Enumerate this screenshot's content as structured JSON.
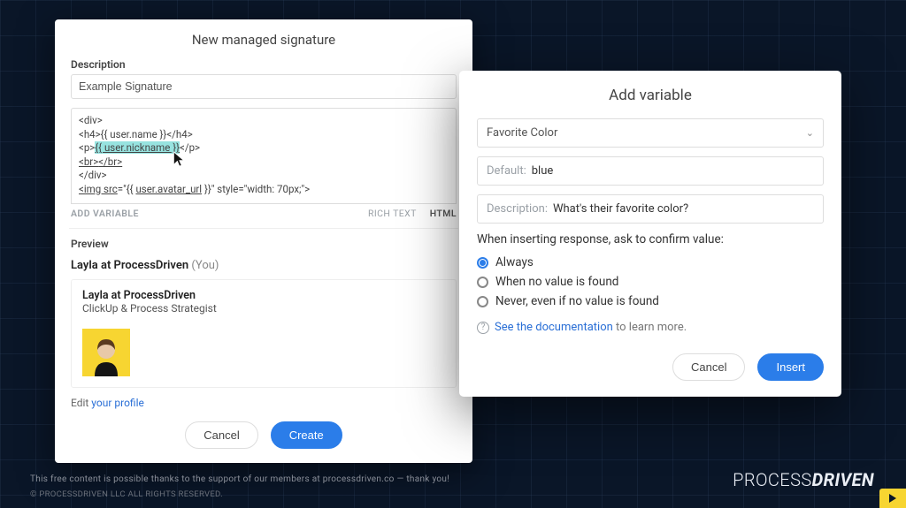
{
  "sig": {
    "title": "New managed signature",
    "desc_label": "Description",
    "desc_value": "Example Signature",
    "code_lines": [
      "<div>",
      "<h4>{{ user.name }}</h4>",
      "<p>{{ user.nickname }}</p>",
      "<br></br>",
      "</div>",
      "<img src=\"{{ user.avatar_url }}\" style=\"width: 70px;\">"
    ],
    "add_variable": "ADD VARIABLE",
    "tab_rich": "RICH TEXT",
    "tab_html": "HTML",
    "preview_label": "Preview",
    "preview_header_name": "Layla at ProcessDriven",
    "preview_header_you": "(You)",
    "card_name": "Layla at ProcessDriven",
    "card_role": "ClickUp & Process Strategist",
    "edit_prefix": "Edit ",
    "edit_link": "your profile",
    "cancel": "Cancel",
    "create": "Create"
  },
  "var": {
    "title": "Add variable",
    "select_value": "Favorite Color",
    "default_label": "Default:",
    "default_value": "blue",
    "desc_label": "Description:",
    "desc_value": "What's their favorite color?",
    "question": "When inserting response, ask to confirm value:",
    "opts": {
      "a": "Always",
      "b": "When no value is found",
      "c": "Never, even if no value is found"
    },
    "doc_link": "See the documentation",
    "doc_suffix": " to learn more.",
    "cancel": "Cancel",
    "insert": "Insert"
  },
  "footer": {
    "line1": "This free content is possible thanks to the support of our members at processdriven.co — thank you!",
    "line2": "© PROCESSDRIVEN LLC ALL RIGHTS RESERVED.",
    "brand_a": "PROCESS",
    "brand_b": "DRIVEN"
  }
}
